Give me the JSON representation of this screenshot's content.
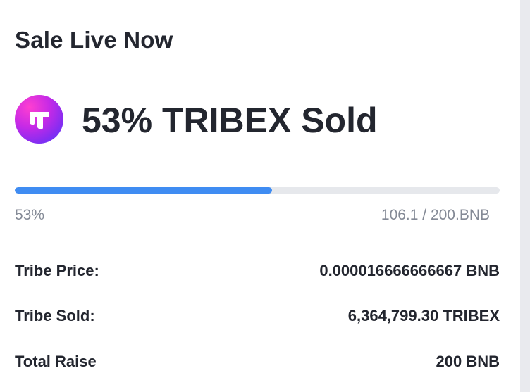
{
  "header": {
    "title": "Sale Live Now"
  },
  "sale": {
    "logo_icon": "tribex-logo-icon",
    "headline": "53% TRIBEX Sold",
    "progress_fraction": 0.53,
    "progress_label": "53%",
    "amount_label": "106.1 / 200.BNB"
  },
  "details": {
    "rows": [
      {
        "label": "Tribe Price:",
        "value": "0.000016666666667 BNB"
      },
      {
        "label": "Tribe Sold:",
        "value": "6,364,799.30 TRIBEX"
      },
      {
        "label": "Total Raise",
        "value": "200 BNB"
      }
    ]
  },
  "colors": {
    "text": "#23262f",
    "muted": "#848a96",
    "accent": "#3f8cf2",
    "track": "#e6e8ec"
  }
}
